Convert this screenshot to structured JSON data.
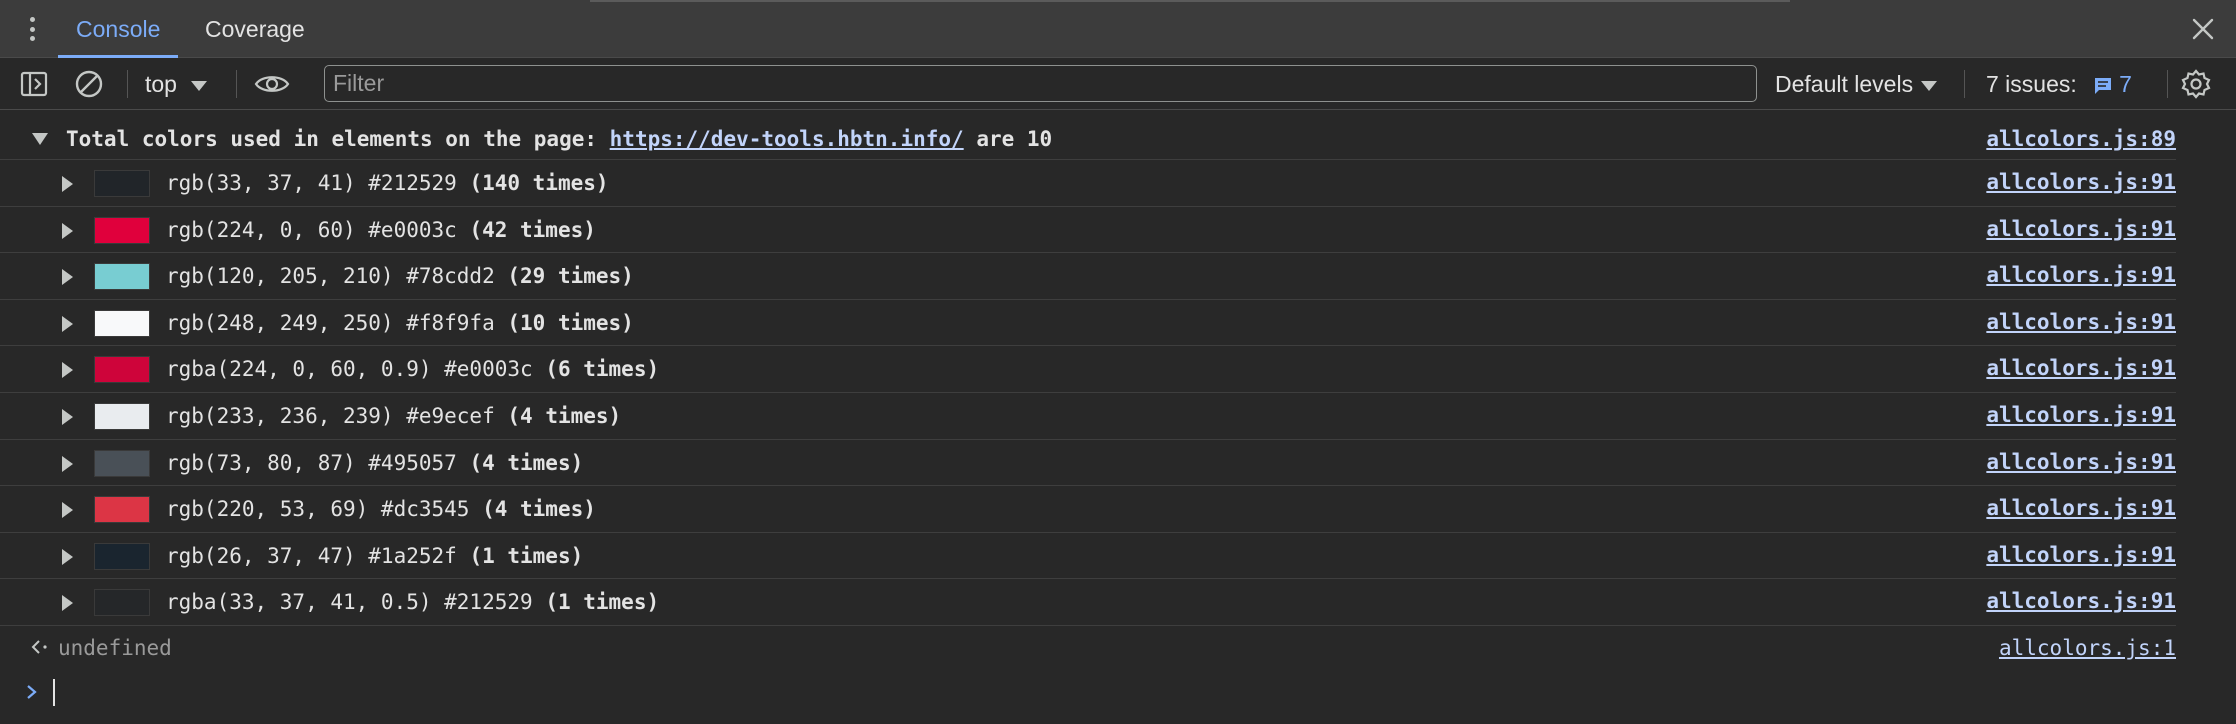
{
  "tabs": {
    "console": "Console",
    "coverage": "Coverage"
  },
  "toolbar": {
    "context": "top",
    "filter_placeholder": "Filter",
    "levels": "Default levels",
    "issues_label": "7 issues:",
    "issues_count": "7"
  },
  "group": {
    "prefix": "Total colors used in elements on the page: ",
    "url": "https://dev-tools.hbtn.info/",
    "suffix": " are 10",
    "source": "allcolors.js:89"
  },
  "rows": [
    {
      "css": "rgb(33, 37, 41) #212529",
      "count": "(140 times)",
      "source": "allcolors.js:91",
      "color": "#212529"
    },
    {
      "css": "rgb(224, 0, 60) #e0003c",
      "count": "(42 times)",
      "source": "allcolors.js:91",
      "color": "#e0003c"
    },
    {
      "css": "rgb(120, 205, 210) #78cdd2",
      "count": "(29 times)",
      "source": "allcolors.js:91",
      "color": "#78cdd2"
    },
    {
      "css": "rgb(248, 249, 250) #f8f9fa",
      "count": "(10 times)",
      "source": "allcolors.js:91",
      "color": "#f8f9fa"
    },
    {
      "css": "rgba(224, 0, 60, 0.9) #e0003c",
      "count": "(6 times)",
      "source": "allcolors.js:91",
      "color": "rgba(224,0,60,0.9)"
    },
    {
      "css": "rgb(233, 236, 239) #e9ecef",
      "count": "(4 times)",
      "source": "allcolors.js:91",
      "color": "#e9ecef"
    },
    {
      "css": "rgb(73, 80, 87) #495057",
      "count": "(4 times)",
      "source": "allcolors.js:91",
      "color": "#495057"
    },
    {
      "css": "rgb(220, 53, 69) #dc3545",
      "count": "(4 times)",
      "source": "allcolors.js:91",
      "color": "#dc3545"
    },
    {
      "css": "rgb(26, 37, 47) #1a252f",
      "count": "(1 times)",
      "source": "allcolors.js:91",
      "color": "#1a252f"
    },
    {
      "css": "rgba(33, 37, 41, 0.5) #212529",
      "count": "(1 times)",
      "source": "allcolors.js:91",
      "color": "rgba(33,37,41,0.5)"
    }
  ],
  "result": {
    "text": "undefined",
    "source": "allcolors.js:1"
  }
}
